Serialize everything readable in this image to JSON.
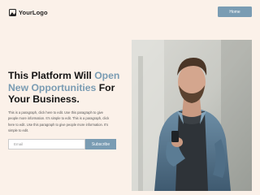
{
  "header": {
    "logo_text": "YourLogo",
    "logo_icon": "image-icon",
    "home_button": "Home"
  },
  "hero": {
    "headline_part1": "This Platform Will ",
    "headline_accent": "Open New Opportunities",
    "headline_part2": " For Your Business.",
    "paragraph": "This is a paragraph, click here to edit. Use this paragraph to give people more information. It's simple to edit. This is a paragraph, click here to edit. Use this paragraph to give people more information. It's simple to edit.",
    "email_placeholder": "Email",
    "subscribe_label": "Subscribe",
    "photo_alt": "Man in denim jacket looking at phone"
  },
  "colors": {
    "background": "#fbf1e9",
    "accent": "#7a9cb3",
    "text": "#141414"
  }
}
